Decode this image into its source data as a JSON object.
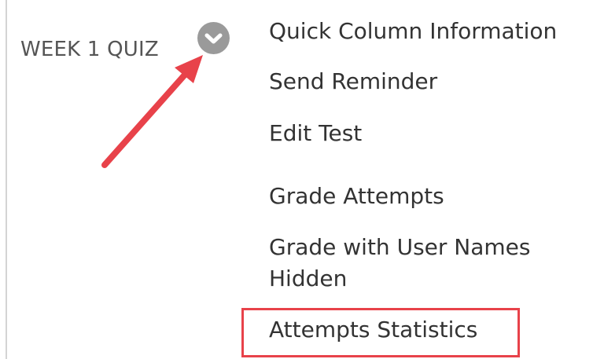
{
  "column": {
    "header": "WEEK 1 QUIZ"
  },
  "menu": {
    "items": [
      {
        "label": "Quick Column Information"
      },
      {
        "label": "Send Reminder"
      },
      {
        "label": "Edit Test"
      },
      {
        "label": "Grade Attempts"
      },
      {
        "label": "Grade with User Names Hidden"
      },
      {
        "label": "Attempts Statistics"
      }
    ]
  },
  "annotations": {
    "arrow_color": "#e8424a",
    "highlight_color": "#e8424a"
  },
  "icons": {
    "menu_toggle": "chevron-down-icon"
  }
}
